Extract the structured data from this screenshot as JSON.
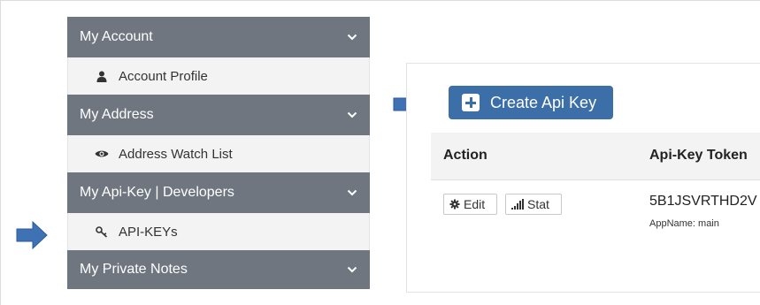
{
  "sidebar": {
    "sections": [
      {
        "header": "My Account",
        "item": {
          "label": "Account Profile",
          "icon": "user-icon"
        }
      },
      {
        "header": "My Address",
        "item": {
          "label": "Address Watch List",
          "icon": "eye-icon"
        }
      },
      {
        "header": "My Api-Key | Developers",
        "item": {
          "label": "API-KEYs",
          "icon": "key-icon"
        }
      },
      {
        "header": "My Private Notes"
      }
    ],
    "header_icon": "chevron-down-icon"
  },
  "main": {
    "create_button_label": "Create Api Key",
    "table": {
      "headers": [
        "Action",
        "Api-Key Token"
      ],
      "rows": [
        {
          "actions": [
            {
              "label": "Edit",
              "icon": "gear-icon"
            },
            {
              "label": "Stat",
              "icon": "signal-bars-icon"
            }
          ],
          "token": "5B1JSVRTHD2V",
          "app_name": "AppName: main"
        }
      ]
    }
  },
  "colors": {
    "sidebar_header_bg": "#6f7680",
    "sidebar_item_bg": "#f3f3f3",
    "primary_button": "#3c6ea8",
    "annotation_arrow": "#3f72b5"
  }
}
